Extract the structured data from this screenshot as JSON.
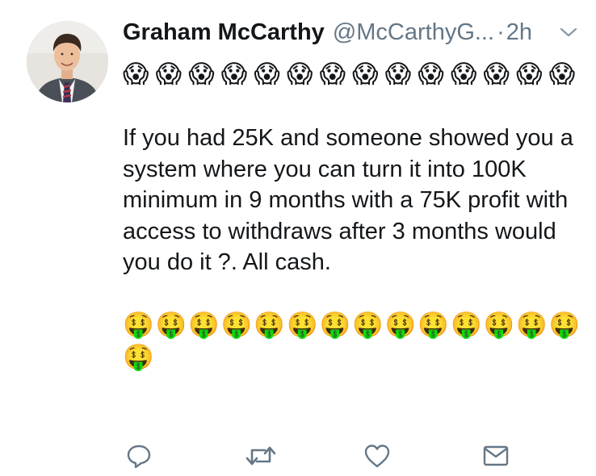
{
  "tweet": {
    "display_name": "Graham McCarthy",
    "handle": "@McCarthyG...",
    "separator": "·",
    "time": "2h",
    "emoji_top": [
      "😱",
      "😱",
      "😱",
      "😱",
      "😱",
      "😱",
      "😱",
      "😱",
      "😱",
      "😱",
      "😱",
      "😱",
      "😱",
      "😱"
    ],
    "text": "If you had 25K and someone showed you a system where you can turn it into 100K minimum in 9 months with a 75K profit with access to withdraws after 3 months would you do it ?. All cash.",
    "emoji_bottom": [
      "🤑",
      "🤑",
      "🤑",
      "🤑",
      "🤑",
      "🤑",
      "🤑",
      "🤑",
      "🤑",
      "🤑",
      "🤑",
      "🤑",
      "🤑",
      "🤑",
      "🤑"
    ]
  },
  "icons": {
    "reply": "reply-icon",
    "retweet": "retweet-icon",
    "like": "like-icon",
    "message": "message-icon",
    "menu": "chevron-down-icon"
  },
  "colors": {
    "text": "#14171a",
    "muted": "#657786",
    "icon": "#657786"
  }
}
